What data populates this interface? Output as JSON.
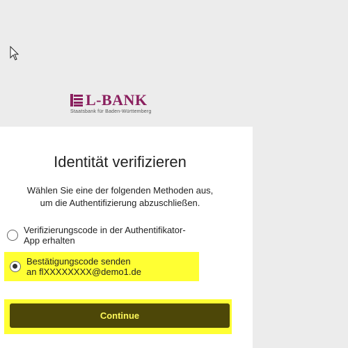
{
  "brand": {
    "name": "L-BANK",
    "subtitle": "Staatsbank für Baden-Württemberg",
    "color": "#8a1f5e"
  },
  "dialog": {
    "title": "Identität verifizieren",
    "description_line1": "Wählen Sie eine der folgenden Methoden aus,",
    "description_line2": "um die Authentifizierung abzuschließen.",
    "options": [
      {
        "label_line1": "Verifizierungscode in der Authentifikator-",
        "label_line2": "App erhalten",
        "selected": false
      },
      {
        "label_line1": "Bestätigungscode senden",
        "label_line2": "an flXXXXXXXX@demo1.de",
        "selected": true
      }
    ],
    "continue_label": "Continue"
  },
  "colors": {
    "background": "#ececec",
    "card": "#ffffff",
    "highlight": "#ffff33",
    "button": "#4d4708",
    "button_text": "#fff95a"
  }
}
